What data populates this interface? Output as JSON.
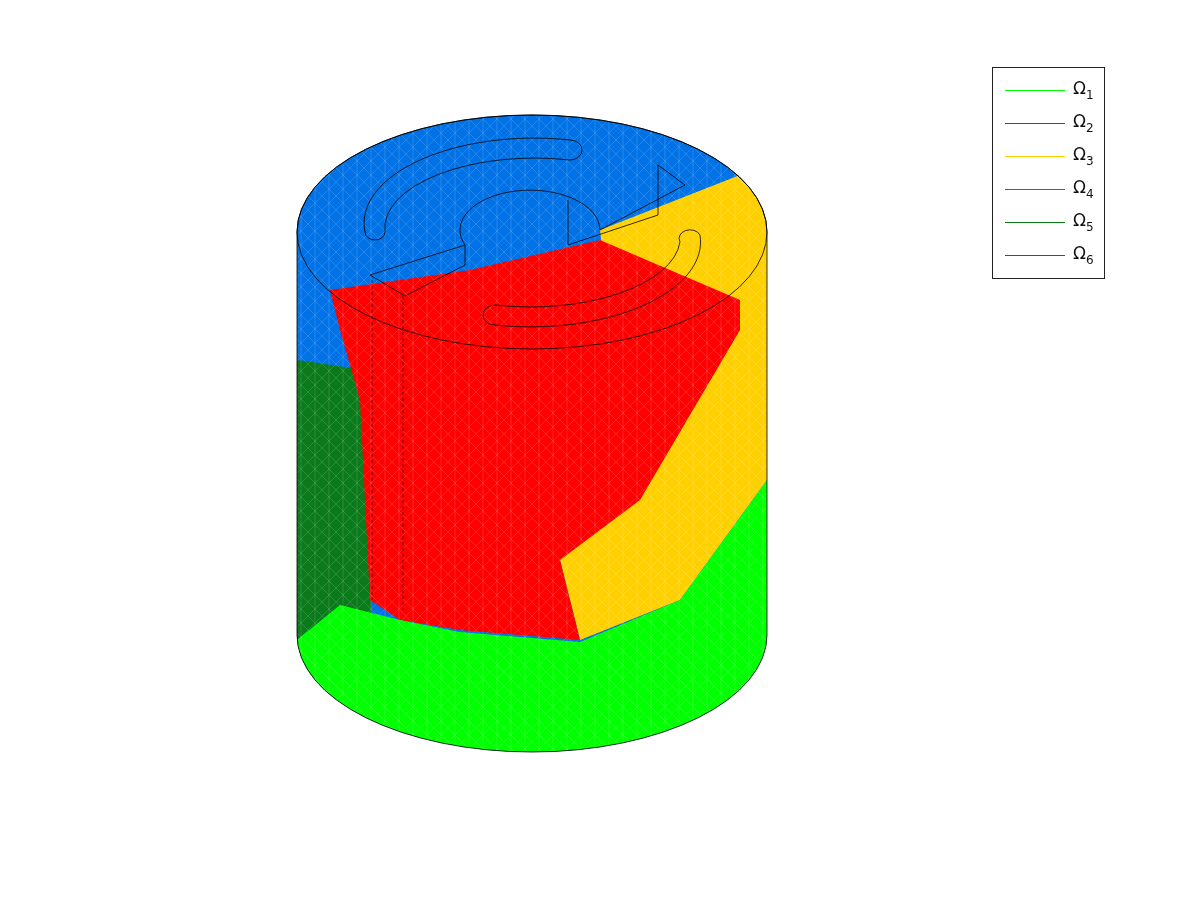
{
  "legend": {
    "items": [
      {
        "label": "Ω$_{1}$",
        "color": "#00ff00"
      },
      {
        "label": "Ω$_{2}$",
        "color": "#ff0000"
      },
      {
        "label": "Ω$_{3}$",
        "color": "#ffd000"
      },
      {
        "label": "Ω$_{4}$",
        "color": "#0072e6"
      },
      {
        "label": "Ω$_{5}$",
        "color": "#0b7a1a"
      },
      {
        "label": "Ω$_{6}$",
        "color": "#a3204c"
      }
    ]
  }
}
